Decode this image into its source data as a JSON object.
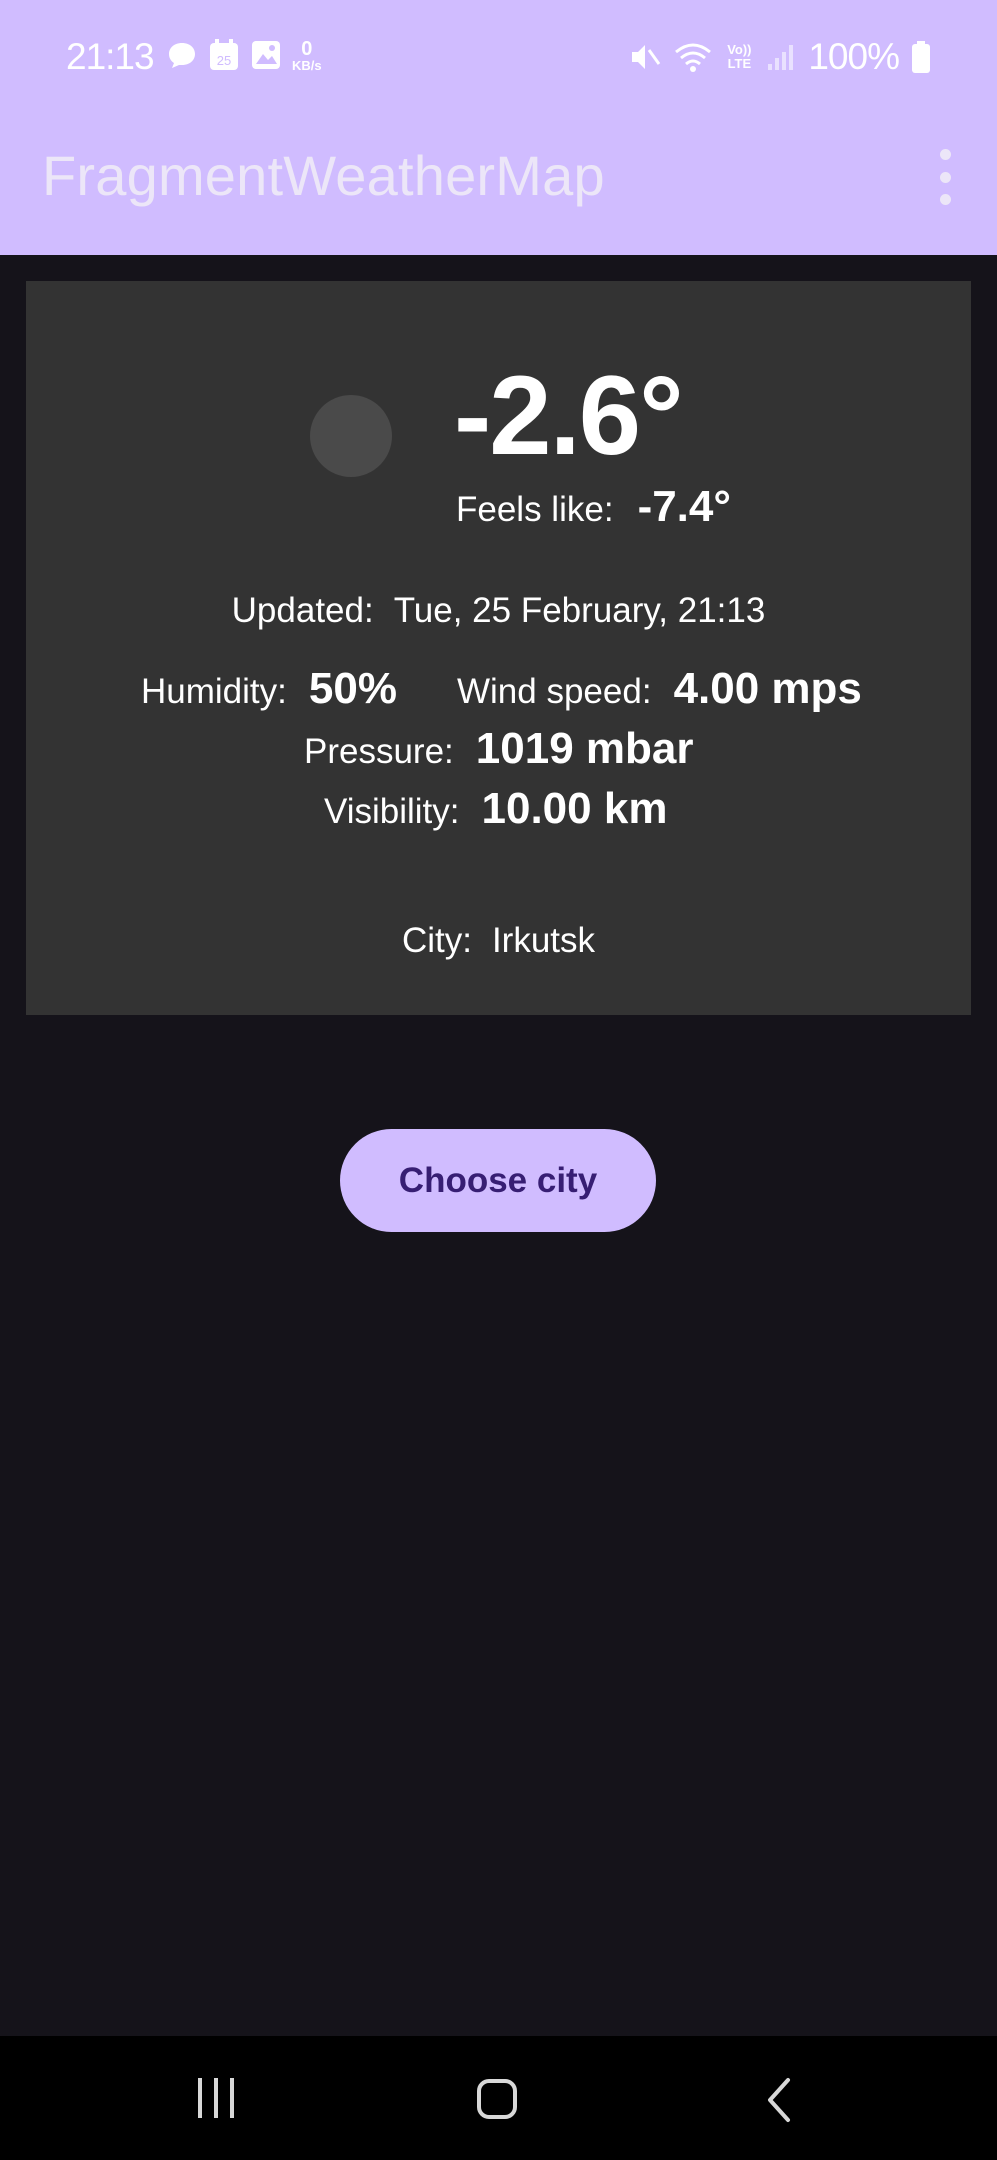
{
  "status_bar": {
    "time": "21:13",
    "notification_icons": [
      "chat-bubble-icon",
      "calendar-icon",
      "image-icon"
    ],
    "calendar_day": "25",
    "net_speed_value": "0",
    "net_speed_unit": "KB/s",
    "right_icons": [
      "mute-vibrate-icon",
      "wifi-icon",
      "volte-icon",
      "signal-icon",
      "battery-icon"
    ],
    "volte_label": "Vo)) LTE",
    "battery": "100%"
  },
  "app_bar": {
    "title": "FragmentWeatherMap",
    "menu_icon": "more-vert-icon"
  },
  "weather": {
    "temperature": "-2.6°",
    "feels_like_label": "Feels like:",
    "feels_like_value": "-7.4°",
    "updated_label": "Updated:",
    "updated_value": "Tue, 25 February, 21:13",
    "humidity_label": "Humidity:",
    "humidity_value": "50%",
    "wind_label": "Wind speed:",
    "wind_value": "4.00 mps",
    "pressure_label": "Pressure:",
    "pressure_value": "1019 mbar",
    "visibility_label": "Visibility:",
    "visibility_value": "10.00 km",
    "city_label": "City:",
    "city_value": "Irkutsk"
  },
  "actions": {
    "choose_city": "Choose city"
  },
  "nav_bar": {
    "icons": [
      "recent-apps-icon",
      "home-icon",
      "back-icon"
    ]
  },
  "colors": {
    "accent": "#d0bcff",
    "background": "#15131a",
    "card": "#333333",
    "button_text": "#371e73"
  }
}
